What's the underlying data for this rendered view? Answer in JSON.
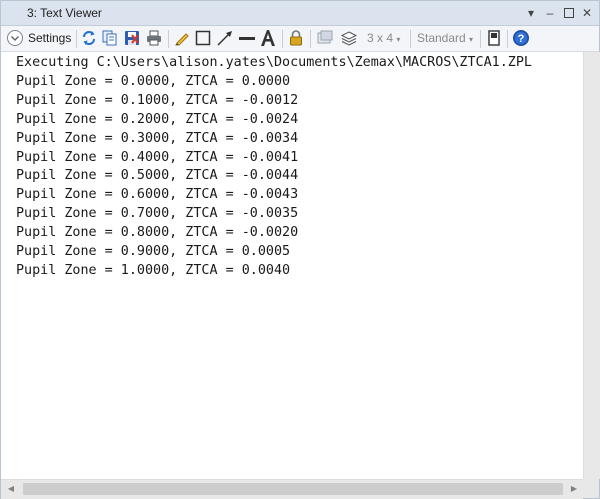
{
  "window": {
    "title": "3: Text Viewer"
  },
  "toolbar": {
    "settings_label": "Settings",
    "layout_label": "3 x 4",
    "standard_label": "Standard"
  },
  "content": {
    "lines": [
      "Executing C:\\Users\\alison.yates\\Documents\\Zemax\\MACROS\\ZTCA1.ZPL",
      "Pupil Zone = 0.0000, ZTCA = 0.0000",
      "Pupil Zone = 0.1000, ZTCA = -0.0012",
      "Pupil Zone = 0.2000, ZTCA = -0.0024",
      "Pupil Zone = 0.3000, ZTCA = -0.0034",
      "Pupil Zone = 0.4000, ZTCA = -0.0041",
      "Pupil Zone = 0.5000, ZTCA = -0.0044",
      "Pupil Zone = 0.6000, ZTCA = -0.0043",
      "Pupil Zone = 0.7000, ZTCA = -0.0035",
      "Pupil Zone = 0.8000, ZTCA = -0.0020",
      "Pupil Zone = 0.9000, ZTCA = 0.0005",
      "Pupil Zone = 1.0000, ZTCA = 0.0040"
    ]
  }
}
